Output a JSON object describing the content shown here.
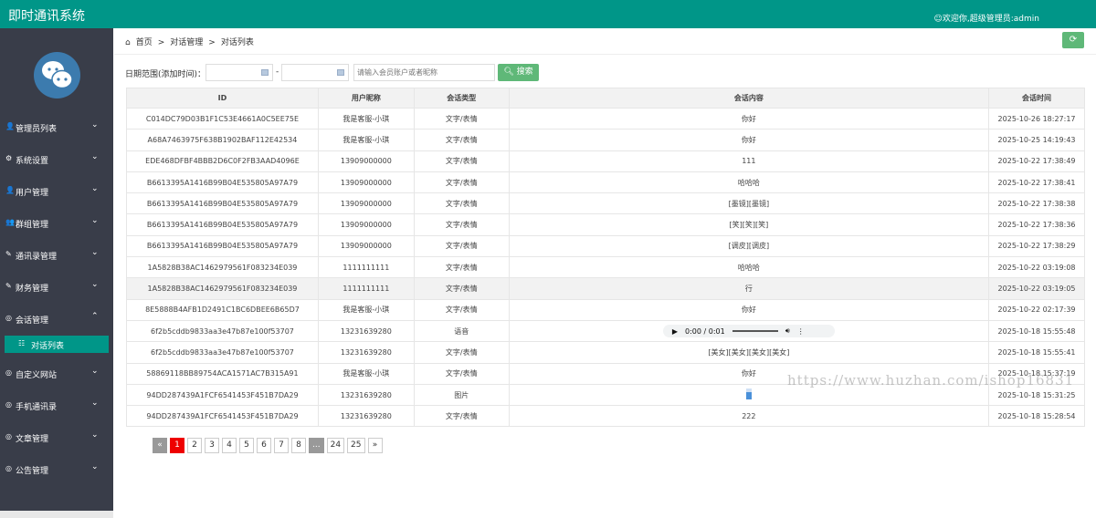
{
  "header": {
    "title": "即时通讯系统",
    "welcome": "☺欢迎你,超级管理员:admin"
  },
  "sidebar": {
    "items": [
      {
        "label": "管理员列表",
        "icon": "user-icon",
        "glyph": "👤",
        "expanded": false
      },
      {
        "label": "系统设置",
        "icon": "gear-icon",
        "glyph": "⚙",
        "expanded": false
      },
      {
        "label": "用户管理",
        "icon": "user-icon",
        "glyph": "👤",
        "expanded": false
      },
      {
        "label": "群组管理",
        "icon": "users-icon",
        "glyph": "👥",
        "expanded": false
      },
      {
        "label": "通讯录管理",
        "icon": "edit-icon",
        "glyph": "✎",
        "expanded": false
      },
      {
        "label": "财务管理",
        "icon": "edit-icon",
        "glyph": "✎",
        "expanded": false
      },
      {
        "label": "会话管理",
        "icon": "chat-icon",
        "glyph": "◎",
        "expanded": true
      },
      {
        "label": "自定义网站",
        "icon": "chat-icon",
        "glyph": "◎",
        "expanded": false
      },
      {
        "label": "手机通讯录",
        "icon": "chat-icon",
        "glyph": "◎",
        "expanded": false
      },
      {
        "label": "文章管理",
        "icon": "chat-icon",
        "glyph": "◎",
        "expanded": false
      },
      {
        "label": "公告管理",
        "icon": "chat-icon",
        "glyph": "◎",
        "expanded": false
      }
    ],
    "sub_item": "对话列表"
  },
  "breadcrumb": [
    "首页",
    "对话管理",
    "对话列表"
  ],
  "filter": {
    "label": "日期范围(添加时间)：",
    "start": "",
    "end": "",
    "dash": "-",
    "search_placeholder": "请输入会员账户或者昵称",
    "search_button": "搜索"
  },
  "table": {
    "columns": [
      "ID",
      "用户昵称",
      "会话类型",
      "会话内容",
      "会话时间"
    ],
    "rows": [
      [
        "C014DC79D03B1F1C53E4661A0C5EE75E",
        "我是客服-小琪",
        "文字/表情",
        "你好",
        "2025-10-26 18:27:17"
      ],
      [
        "A68A7463975F638B1902BAF112E42534",
        "我是客服-小琪",
        "文字/表情",
        "你好",
        "2025-10-25 14:19:43"
      ],
      [
        "EDE468DFBF4BBB2D6C0F2FB3AAD4096E",
        "13909000000",
        "文字/表情",
        "111",
        "2025-10-22 17:38:49"
      ],
      [
        "B6613395A1416B99B04E535805A97A79",
        "13909000000",
        "文字/表情",
        "哈哈哈",
        "2025-10-22 17:38:41"
      ],
      [
        "B6613395A1416B99B04E535805A97A79",
        "13909000000",
        "文字/表情",
        "[墨镜][墨镜]",
        "2025-10-22 17:38:38"
      ],
      [
        "B6613395A1416B99B04E535805A97A79",
        "13909000000",
        "文字/表情",
        "[笑][笑][笑]",
        "2025-10-22 17:38:36"
      ],
      [
        "B6613395A1416B99B04E535805A97A79",
        "13909000000",
        "文字/表情",
        "[调皮][调皮]",
        "2025-10-22 17:38:29"
      ],
      [
        "1A5828B38AC1462979561F083234E039",
        "1111111111",
        "文字/表情",
        "哈哈哈",
        "2025-10-22 03:19:08"
      ],
      [
        "1A5828B38AC1462979561F083234E039",
        "1111111111",
        "文字/表情",
        "行",
        "2025-10-22 03:19:05"
      ],
      [
        "8E5888B4AFB1D2491C1BC6DBEE6B65D7",
        "我是客服-小琪",
        "文字/表情",
        "你好",
        "2025-10-22 02:17:39"
      ],
      [
        "6f2b5cddb9833aa3e47b87e100f53707",
        "13231639280",
        "语音",
        "0:00 / 0:01",
        "2025-10-18 15:55:48"
      ],
      [
        "6f2b5cddb9833aa3e47b87e100f53707",
        "13231639280",
        "文字/表情",
        "[美女][美女][美女][美女]",
        "2025-10-18 15:55:41"
      ],
      [
        "58869118BB89754ACA1571AC7B315A91",
        "我是客服-小琪",
        "文字/表情",
        "你好",
        "2025-10-18 15:37:19"
      ],
      [
        "94DD287439A1FCF6541453F451B7DA29",
        "13231639280",
        "图片",
        "",
        "2025-10-18 15:31:25"
      ],
      [
        "94DD287439A1FCF6541453F451B7DA29",
        "13231639280",
        "文字/表情",
        "222",
        "2025-10-18 15:28:54"
      ]
    ]
  },
  "pagination": {
    "prev": "«",
    "pages": [
      "1",
      "2",
      "3",
      "4",
      "5",
      "6",
      "7",
      "8",
      "...",
      "24",
      "25"
    ],
    "current": "1",
    "next": "»"
  },
  "watermark": "https://www.huzhan.com/ishop16831"
}
